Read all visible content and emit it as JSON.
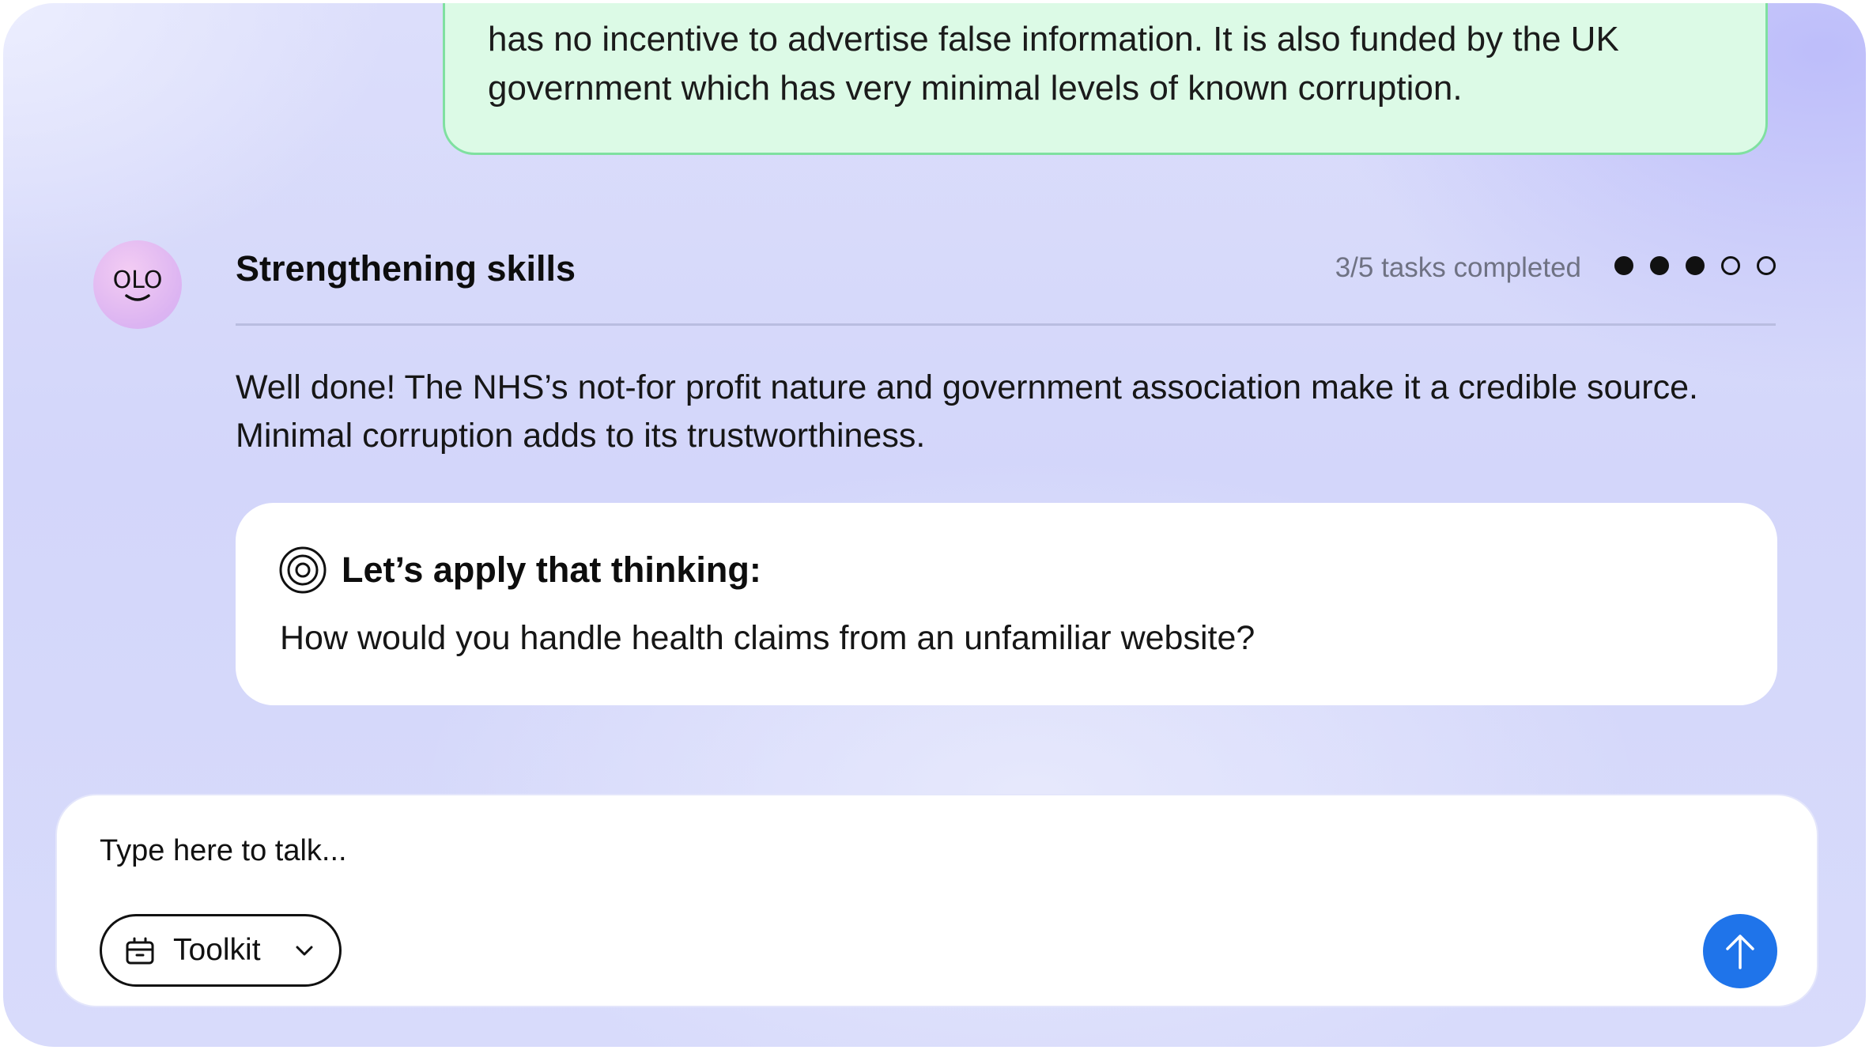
{
  "colors": {
    "user_bubble_bg": "#dcfae6",
    "user_bubble_border": "#7fe0a0",
    "send_button": "#1f74ea",
    "progress_text": "#6f7283",
    "avatar": "#dcb4f2"
  },
  "previous_message": {
    "line1": "has no incentive to advertise false information. It is also funded by the UK",
    "line2": "government which has very minimal levels of known corruption."
  },
  "assistant": {
    "avatar_text": "OLO",
    "title": "Strengthening skills",
    "progress_text": "3/5 tasks completed",
    "progress": {
      "completed": 3,
      "total": 5
    },
    "message_line1": "Well done! The NHS’s not-for profit nature and government association make it a credible source.",
    "message_line2": "Minimal corruption adds to its trustworthiness.",
    "apply_card": {
      "icon": "target-icon",
      "title": "Let’s apply that thinking:",
      "question": "How would you handle health claims from an unfamiliar website?"
    }
  },
  "composer": {
    "placeholder": "Type here to talk...",
    "toolkit_label": "Toolkit",
    "toolkit_icon": "toolkit-icon",
    "dropdown_icon": "chevron-down-icon",
    "send_icon": "arrow-up-icon"
  }
}
